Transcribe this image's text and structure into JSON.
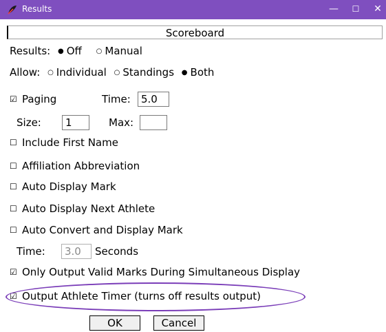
{
  "window": {
    "title": "Results",
    "minimize_glyph": "—",
    "maximize_glyph": "☐",
    "close_glyph": "✕",
    "icon": "app-feather-icon"
  },
  "section": {
    "label": "Scoreboard"
  },
  "results": {
    "label": "Results:",
    "options": [
      {
        "label": "Off",
        "selected": true,
        "glyph": "●"
      },
      {
        "label": "Manual",
        "selected": false,
        "glyph": "○"
      }
    ]
  },
  "allow": {
    "label": "Allow:",
    "options": [
      {
        "label": "Individual",
        "selected": false,
        "glyph": "○"
      },
      {
        "label": "Standings",
        "selected": false,
        "glyph": "○"
      },
      {
        "label": "Both",
        "selected": true,
        "glyph": "●"
      }
    ]
  },
  "paging": {
    "label": "Paging",
    "checked": true,
    "glyph": "☑",
    "time_label": "Time:",
    "time_value": "5.0",
    "size_label": "Size:",
    "size_value": "1",
    "max_label": "Max:",
    "max_value": ""
  },
  "checkboxes": [
    {
      "label": "Include First Name",
      "checked": false,
      "glyph": "☐"
    },
    {
      "label": "Affiliation Abbreviation",
      "checked": false,
      "glyph": "☐"
    },
    {
      "label": "Auto Display Mark",
      "checked": false,
      "glyph": "☐"
    },
    {
      "label": "Auto Display Next Athlete",
      "checked": false,
      "glyph": "☐"
    },
    {
      "label": "Auto Convert and Display Mark",
      "checked": false,
      "glyph": "☐"
    }
  ],
  "convert_time": {
    "label": "Time:",
    "value": "3.0",
    "unit": "Seconds"
  },
  "only_valid": {
    "label": "Only Output Valid Marks During Simultaneous Display",
    "checked": true,
    "glyph": "☑"
  },
  "athlete_timer": {
    "label": "Output Athlete Timer (turns off results output)",
    "checked": true,
    "glyph": "☑"
  },
  "buttons": {
    "ok": "OK",
    "cancel": "Cancel"
  },
  "colors": {
    "titlebar": "#7f4fbf",
    "highlight": "#7a3db8"
  }
}
